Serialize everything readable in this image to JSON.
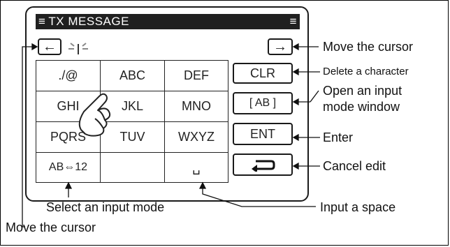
{
  "screen": {
    "title": "TX MESSAGE",
    "cursor_left_glyph": "←",
    "cursor_right_glyph": "→",
    "keys": [
      "./@",
      "ABC",
      "DEF",
      "GHI",
      "JKL",
      "MNO",
      "PQRS",
      "TUV",
      "WXYZ",
      "AB⇔12",
      "",
      "␣"
    ],
    "side_buttons": {
      "clr": "CLR",
      "mode": "[ AB ]",
      "ent": "ENT",
      "back": "⮌"
    }
  },
  "callouts": {
    "move_cursor_right": "Move the cursor",
    "delete_char": "Delete a character",
    "open_input_mode_line1": "Open an input",
    "open_input_mode_line2": "mode window",
    "enter": "Enter",
    "cancel_edit": "Cancel edit",
    "select_input_mode": "Select an input mode",
    "input_space": "Input a space",
    "move_cursor_left": "Move the cursor"
  },
  "icons": {
    "hand": "pointing-hand-icon",
    "blink": "cursor-blink-icon"
  }
}
